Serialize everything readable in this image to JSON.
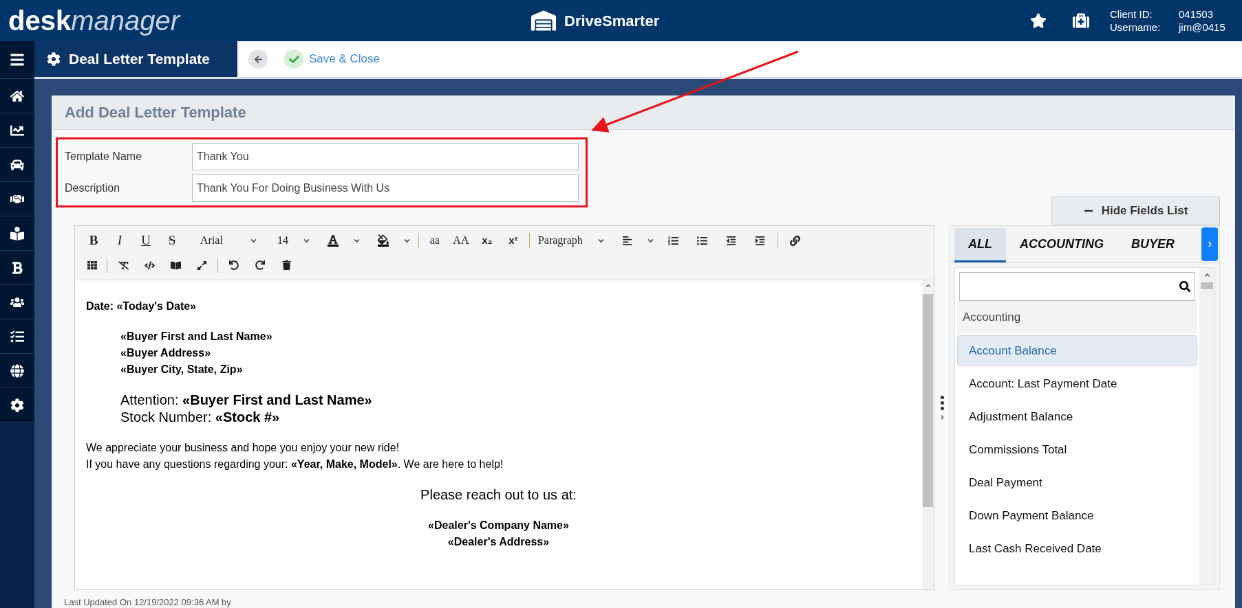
{
  "header": {
    "logo_bold": "desk",
    "logo_italic": "manager",
    "brand": "DriveSmarter",
    "client_id_label": "Client ID:",
    "client_id": "041503",
    "username_label": "Username:",
    "username": "jim@0415"
  },
  "page": {
    "title": "Deal Letter Template",
    "save_button": "Save & Close"
  },
  "form": {
    "title": "Add Deal Letter Template",
    "fields": [
      {
        "label": "Template Name",
        "value": "Thank You"
      },
      {
        "label": "Description",
        "value": "Thank You For Doing Business With Us"
      }
    ]
  },
  "editor": {
    "toolbar": {
      "format_buttons": [
        "B",
        "I",
        "U",
        "S"
      ],
      "font": "Arial",
      "size": "14",
      "case_buttons": [
        "aa",
        "AA"
      ],
      "script_buttons": [
        "x₂",
        "x²"
      ],
      "block": "Paragraph"
    },
    "blocks": [
      {
        "kind": "plain",
        "lines": [
          {
            "text": "Date: «Today's Date»",
            "bold": true
          }
        ]
      },
      {
        "kind": "indented",
        "lines": [
          {
            "text": "«Buyer First and Last Name»",
            "bold": true
          },
          {
            "text": "«Buyer Address»",
            "bold": true
          },
          {
            "text": "«Buyer City, State, Zip»",
            "bold": true
          }
        ]
      },
      {
        "kind": "heading",
        "lines": [
          {
            "text": "Attention: **«Buyer First and Last Name»**",
            "bold": false
          },
          {
            "text": "Stock Number: **«Stock #»**",
            "bold": false
          }
        ]
      },
      {
        "kind": "plain",
        "lines": [
          {
            "text": "We appreciate your business and hope you enjoy your new ride!",
            "bold": false
          },
          {
            "text": "If you have any questions regarding your: **«Year, Make, Model»**. We are here to help!",
            "bold": false
          }
        ]
      },
      {
        "kind": "callout",
        "lines": [
          {
            "text": "Please reach out to us at:",
            "bold": false
          }
        ]
      },
      {
        "kind": "centered",
        "lines": [
          {
            "text": "«Dealer's Company Name»",
            "bold": true
          },
          {
            "text": "«Dealer's Address»",
            "bold": true
          }
        ]
      }
    ]
  },
  "fields_panel": {
    "hide_button": "Hide Fields List",
    "tabs": [
      {
        "label": "ALL",
        "selected": true
      },
      {
        "label": "ACCOUNTING",
        "selected": false
      },
      {
        "label": "BUYER",
        "selected": false
      }
    ],
    "group": "Accounting",
    "items": [
      {
        "label": "Account Balance",
        "selected": true
      },
      {
        "label": "Account: Last Payment Date",
        "selected": false
      },
      {
        "label": "Adjustment Balance",
        "selected": false
      },
      {
        "label": "Commissions Total",
        "selected": false
      },
      {
        "label": "Deal Payment",
        "selected": false
      },
      {
        "label": "Down Payment Balance",
        "selected": false
      },
      {
        "label": "Last Cash Received Date",
        "selected": false
      }
    ]
  },
  "footer": "Last Updated On 12/19/2022 09:36 AM by"
}
